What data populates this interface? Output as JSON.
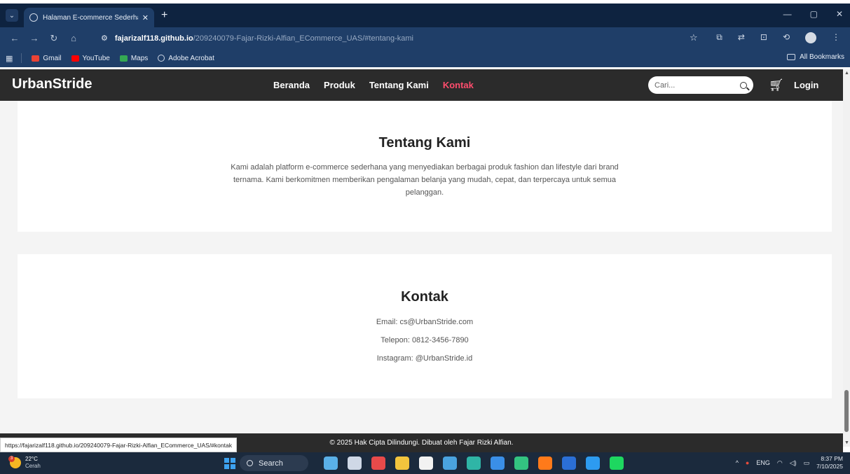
{
  "browser": {
    "tab_title": "Halaman E-commerce Sederha",
    "tab_close": "✕",
    "new_tab": "+",
    "url_host": "fajarizalf118.github.io",
    "url_path": "/209240079-Fajar-Rizki-Alfian_ECommerce_UAS/#tentang-kami",
    "bookmarks": [
      {
        "label": "Gmail",
        "color": "#ea4335"
      },
      {
        "label": "YouTube",
        "color": "#ff0000"
      },
      {
        "label": "Maps",
        "color": "#34a853"
      },
      {
        "label": "Adobe Acrobat",
        "color": "#cfd8e6"
      }
    ],
    "all_bookmarks": "All Bookmarks"
  },
  "site": {
    "brand": "UrbanStride",
    "menu": [
      "Beranda",
      "Produk",
      "Tentang Kami",
      "Kontak"
    ],
    "active_menu": "Kontak",
    "search_placeholder": "Cari...",
    "login": "Login"
  },
  "about": {
    "title": "Tentang Kami",
    "text": "Kami adalah platform e-commerce sederhana yang menyediakan berbagai produk fashion dan lifestyle dari brand ternama. Kami berkomitmen memberikan pengalaman belanja yang mudah, cepat, dan terpercaya untuk semua pelanggan."
  },
  "contact": {
    "title": "Kontak",
    "email": "Email: cs@UrbanStride.com",
    "phone": "Telepon: 0812-3456-7890",
    "instagram": "Instagram: @UrbanStride.id"
  },
  "footer": {
    "text": "© 2025 Hak Cipta Dilindungi. Dibuat oleh Fajar Rizki Alfian.",
    "status_url": "https://fajarizalf118.github.io/209240079-Fajar-Rizki-Alfian_ECommerce_UAS/#kontak"
  },
  "taskbar": {
    "temperature": "22°C",
    "condition": "Cerah",
    "weather_badge": "3",
    "search": "Search",
    "language": "ENG",
    "time": "8:37 PM",
    "date": "7/10/2025",
    "apps": [
      "#5ab0e8",
      "#cfd8e6",
      "#e84a4a",
      "#f2c43d",
      "#f2f2f2",
      "#4aa3df",
      "#2fb5a6",
      "#3a8fe8",
      "#33c481",
      "#ff7a1a",
      "#2b6fd6",
      "#2d9bf0",
      "#1ed760"
    ]
  }
}
